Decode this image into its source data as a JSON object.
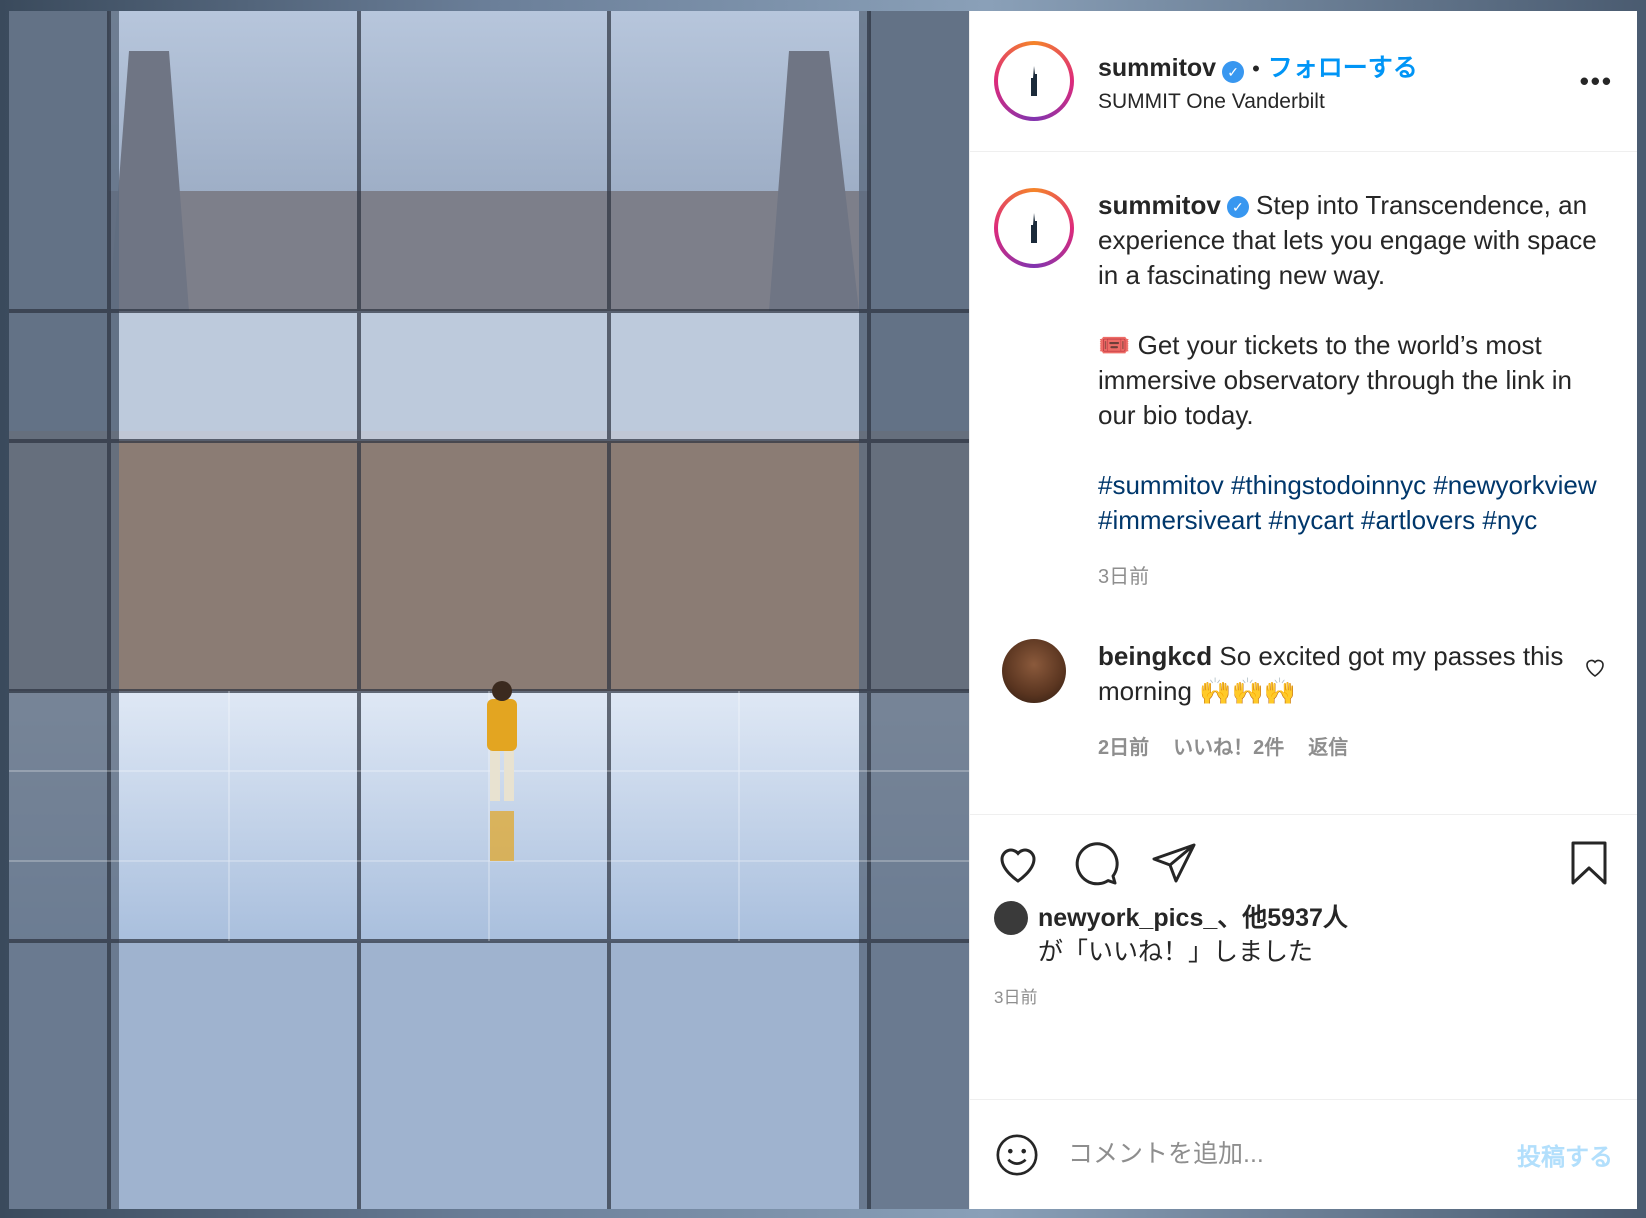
{
  "header": {
    "username": "summitov",
    "verified_badge": "✓",
    "dot": "•",
    "follow_label": "フォローする",
    "location": "SUMMIT One Vanderbilt",
    "more_label": "•••"
  },
  "caption": {
    "username": "summitov",
    "line1": "Step into Transcendence, an experience that lets you engage with space in a fascinating new way.",
    "ticket_emoji": "🎟️",
    "line2": "Get your tickets to the world’s most immersive observatory through the link in our bio today.",
    "hashtags": [
      "#summitov",
      "#thingstodoinnyc",
      "#newyorkview",
      "#immersiveart",
      "#nycart",
      "#artlovers",
      "#nyc"
    ],
    "time": "3日前"
  },
  "comment": {
    "username": "beingkcd",
    "text": "So excited got my passes this morning 🙌🙌🙌",
    "time": "2日前",
    "likes": "いいね！2件",
    "reply": "返信"
  },
  "likes": {
    "user": "newyork_pics_",
    "others": "、他5937人",
    "suffix": "が「いいね！」しました"
  },
  "post_time": "3日前",
  "add_comment": {
    "placeholder": "コメントを追加...",
    "post_label": "投稿する"
  },
  "colors": {
    "link": "#0095f6",
    "hashtag": "#00376b",
    "muted": "#8e8e8e"
  }
}
